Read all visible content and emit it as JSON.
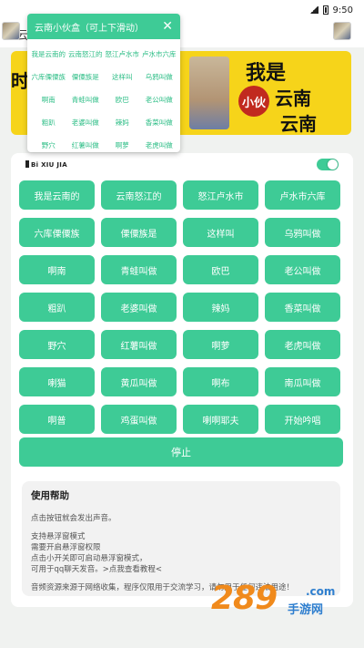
{
  "status_bar": {
    "time": "9:50"
  },
  "header": {
    "title": "云南"
  },
  "banner": {
    "line1": "我是",
    "line2": "云南",
    "line3": "云南",
    "stamp": "小伙",
    "side": "时"
  },
  "floating_window": {
    "title": "云南小伙盒（可上下滑动）",
    "close": "✕",
    "items": [
      "我是云南的",
      "云南怒江的",
      "怒江卢水市",
      "卢水市六库",
      "六库傈僳族",
      "傈僳族是",
      "这样叫",
      "乌鸦叫做",
      "啊南",
      "青蛙叫做",
      "欧巴",
      "老公叫做",
      "粗趴",
      "老婆叫做",
      "辣妈",
      "香菜叫做",
      "野穴",
      "红薯叫做",
      "啊萝",
      "老虎叫做"
    ]
  },
  "card": {
    "logo_text": "Bi XIU JIA",
    "sound_buttons": [
      "我是云南的",
      "云南怒江的",
      "怒江卢水市",
      "卢水市六库",
      "六库傈僳族",
      "傈僳族是",
      "这样叫",
      "乌鸦叫做",
      "啊南",
      "青蛙叫做",
      "欧巴",
      "老公叫做",
      "粗趴",
      "老婆叫做",
      "辣妈",
      "香菜叫做",
      "野穴",
      "红薯叫做",
      "啊萝",
      "老虎叫做",
      "喇猫",
      "黄瓜叫做",
      "啊布",
      "南瓜叫做",
      "啊普",
      "鸡蛋叫做",
      "喇啊耶夫",
      "开始吟唱"
    ],
    "stop_label": "停止",
    "help": {
      "title": "使用帮助",
      "lines": [
        "点击按钮就会发出声音。",
        "",
        "支持悬浮窗模式",
        "需要开启悬浮窗权限",
        "点击小开关即可启动悬浮窗模式，",
        "可用于qq聊天发音。>点我查看教程<",
        "",
        "音频资源来源于网络收集，程序仅限用于交流学习，请勿用于任何违法用途！"
      ]
    }
  },
  "watermark": {
    "number": "289",
    "domain": ".com",
    "text": "手游网"
  },
  "colors": {
    "accent": "#3ecb96",
    "banner": "#f6d41a"
  }
}
